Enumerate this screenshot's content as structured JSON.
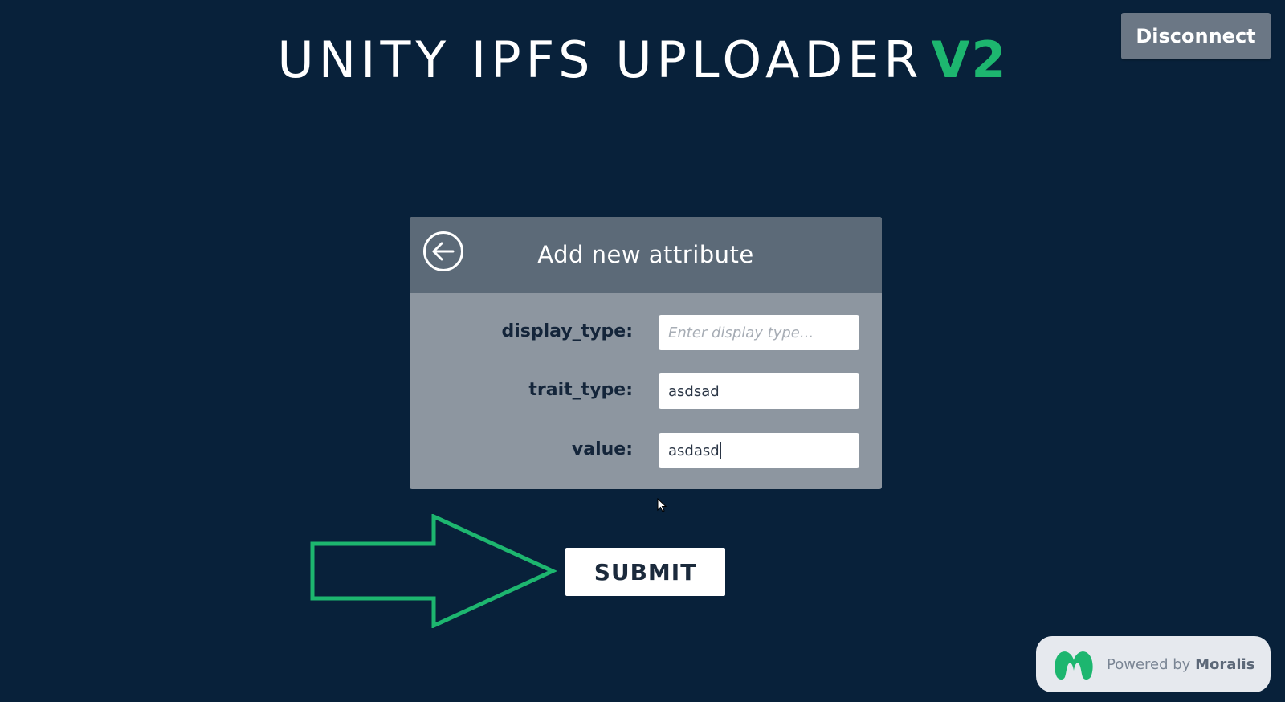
{
  "header": {
    "title_main": "UNITY IPFS UPLOADER",
    "title_accent": "V2",
    "accent_color": "#1db66f"
  },
  "disconnect_label": "Disconnect",
  "dialog": {
    "title": "Add new attribute",
    "back_icon": "back-arrow-circle-icon",
    "fields": [
      {
        "label": "display_type:",
        "value": "",
        "placeholder": "Enter display type..."
      },
      {
        "label": "trait_type:",
        "value": "asdsad",
        "placeholder": ""
      },
      {
        "label": "value:",
        "value": "asdasd",
        "placeholder": ""
      }
    ]
  },
  "submit_label": "SUBMIT",
  "annotation_arrow_color": "#1db66f",
  "footer": {
    "powered_by": "Powered by",
    "brand": "Moralis",
    "brand_color": "#1db66f"
  }
}
